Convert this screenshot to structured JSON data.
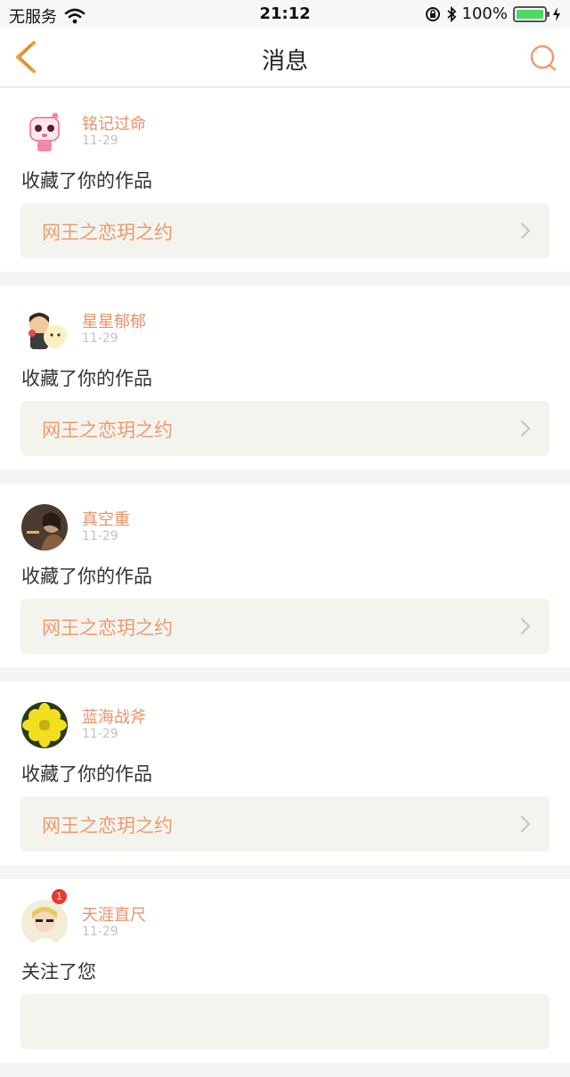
{
  "status_bar": {
    "carrier": "无服务",
    "time": "21:12",
    "battery": "100%",
    "battery_color": "#4cd964"
  },
  "nav": {
    "title": "消息",
    "back_icon": "chevron-left-icon",
    "search_icon": "search-icon",
    "accent": "#e8a33c"
  },
  "messages": [
    {
      "user": "铭记过命",
      "date": "11-29",
      "action": "收藏了你的作品",
      "work": "网王之恋玥之约"
    },
    {
      "user": "星星郁郁",
      "date": "11-29",
      "action": "收藏了你的作品",
      "work": "网王之恋玥之约"
    },
    {
      "user": "真空重",
      "date": "11-29",
      "action": "收藏了你的作品",
      "work": "网王之恋玥之约"
    },
    {
      "user": "蓝海战斧",
      "date": "11-29",
      "action": "收藏了你的作品",
      "work": "网王之恋玥之约"
    },
    {
      "user": "天涯直尺",
      "date": "11-29",
      "action": "关注了您",
      "work": "",
      "badge": "1"
    }
  ]
}
